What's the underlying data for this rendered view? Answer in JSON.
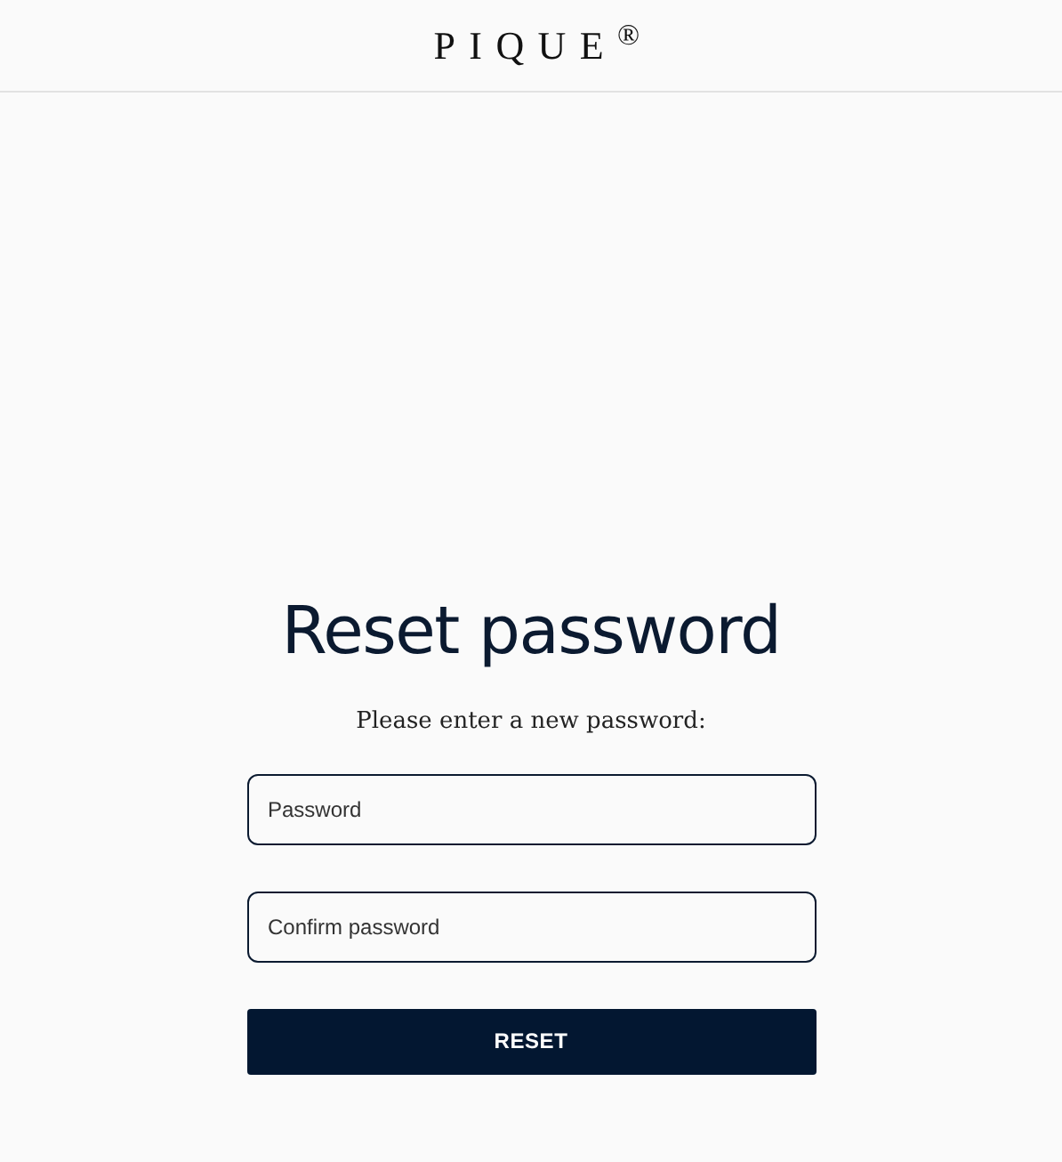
{
  "header": {
    "logo": "PIQUE$^{®}$"
  },
  "form": {
    "title": "Reset password",
    "instruction": "Please enter a new password:",
    "fields": [
      {
        "placeholder": "Password"
      },
      {
        "placeholder": "Confirm password"
      }
    ],
    "submit_button": "RESET"
  }
}
